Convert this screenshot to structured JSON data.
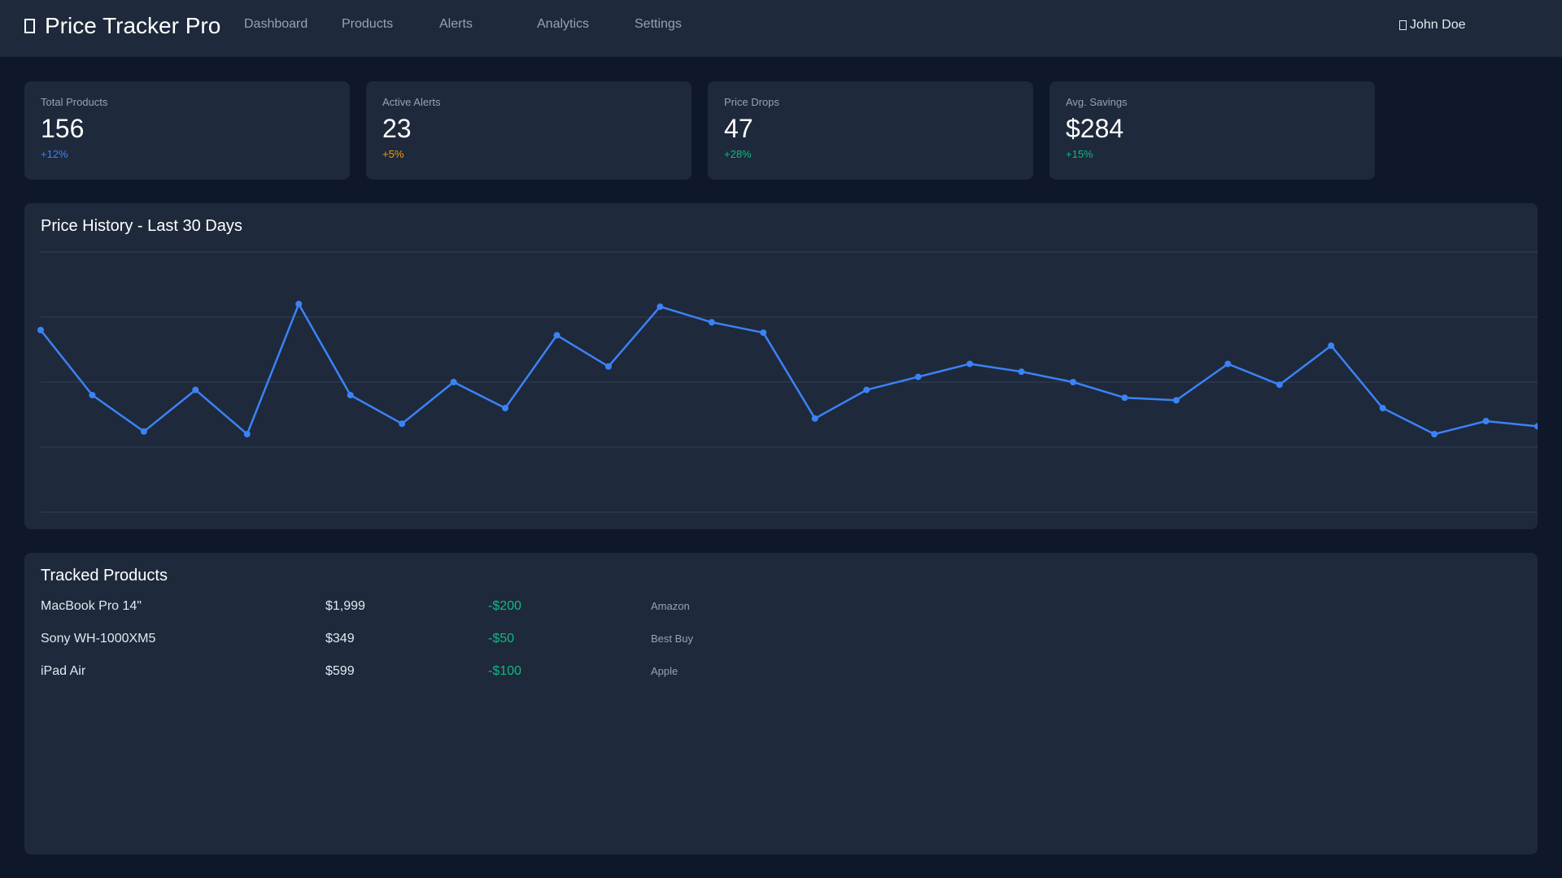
{
  "app": {
    "title": "Price Tracker Pro",
    "logo_icon": "square-icon"
  },
  "nav": {
    "items": [
      {
        "label": "Dashboard"
      },
      {
        "label": "Products"
      },
      {
        "label": "Alerts"
      },
      {
        "label": "Analytics"
      },
      {
        "label": "Settings"
      }
    ]
  },
  "user": {
    "name": "John Doe",
    "icon": "user-icon"
  },
  "stats": [
    {
      "label": "Total Products",
      "value": "156",
      "change": "+12%",
      "color": "#3b82f6"
    },
    {
      "label": "Active Alerts",
      "value": "23",
      "change": "+5%",
      "color": "#f59e0b"
    },
    {
      "label": "Price Drops",
      "value": "47",
      "change": "+28%",
      "color": "#10b981"
    },
    {
      "label": "Avg. Savings",
      "value": "$284",
      "change": "+15%",
      "color": "#10b981"
    }
  ],
  "chart": {
    "title": "Price History - Last 30 Days"
  },
  "chart_data": {
    "type": "line",
    "title": "Price History - Last 30 Days",
    "xlabel": "",
    "ylabel": "",
    "grid": true,
    "ylim": [
      0,
      100
    ],
    "line_color": "#3b82f6",
    "series": [
      {
        "values": [
          70,
          45,
          31,
          47,
          30,
          80,
          45,
          34,
          50,
          40,
          68,
          56,
          79,
          73,
          69,
          36,
          47,
          52,
          57,
          54,
          50,
          44,
          43,
          57,
          49,
          64,
          40,
          30,
          35,
          33
        ]
      }
    ]
  },
  "products": {
    "title": "Tracked Products",
    "rows": [
      {
        "name": "MacBook Pro 14\"",
        "price": "$1,999",
        "change": "-$200",
        "store": "Amazon"
      },
      {
        "name": "Sony WH-1000XM5",
        "price": "$349",
        "change": "-$50",
        "store": "Best Buy"
      },
      {
        "name": "iPad Air",
        "price": "$599",
        "change": "-$100",
        "store": "Apple"
      }
    ]
  }
}
